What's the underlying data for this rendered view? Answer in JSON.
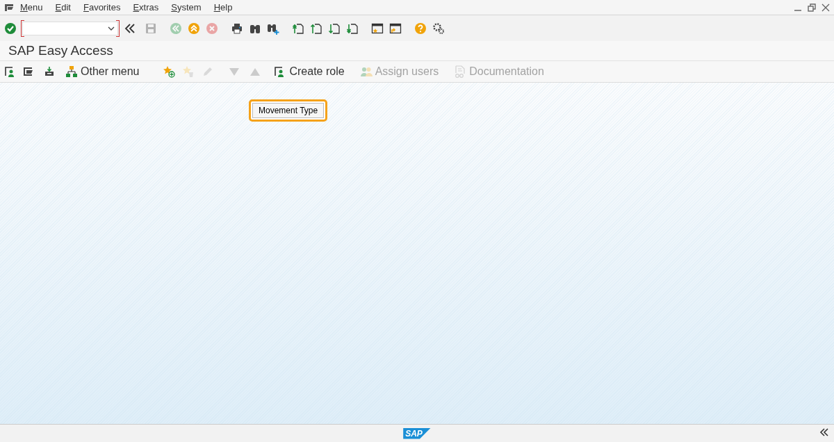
{
  "menu_bar": {
    "items": [
      "Menu",
      "Edit",
      "Favorites",
      "Extras",
      "System",
      "Help"
    ]
  },
  "system_toolbar": {
    "items": [
      {
        "kind": "enter",
        "disabled": false
      },
      {
        "kind": "command-field",
        "disabled": false
      },
      {
        "kind": "collapse",
        "disabled": false
      },
      {
        "kind": "save",
        "disabled": true
      },
      {
        "kind": "back",
        "disabled": true
      },
      {
        "kind": "exit",
        "disabled": false
      },
      {
        "kind": "cancel",
        "disabled": true
      },
      {
        "kind": "print",
        "disabled": false
      },
      {
        "kind": "find",
        "disabled": false
      },
      {
        "kind": "find-next",
        "disabled": false
      },
      {
        "kind": "first-page",
        "disabled": false
      },
      {
        "kind": "previous-page",
        "disabled": false
      },
      {
        "kind": "next-page",
        "disabled": false
      },
      {
        "kind": "last-page",
        "disabled": false
      },
      {
        "kind": "new-session",
        "disabled": false
      },
      {
        "kind": "shortcut",
        "disabled": false
      },
      {
        "kind": "help",
        "disabled": false
      },
      {
        "kind": "settings",
        "disabled": false
      }
    ]
  },
  "title": "SAP Easy Access",
  "application_toolbar": {
    "items": [
      {
        "kind": "user-menu",
        "disabled": false
      },
      {
        "kind": "sap-menu",
        "disabled": false
      },
      {
        "kind": "business-workplace",
        "disabled": false
      },
      {
        "kind": "other-menu",
        "label": "Other menu",
        "disabled": false
      },
      {
        "kind": "add-favorite",
        "disabled": false
      },
      {
        "kind": "delete-favorite",
        "disabled": true
      },
      {
        "kind": "edit",
        "disabled": true
      },
      {
        "kind": "move-down",
        "disabled": true
      },
      {
        "kind": "move-up",
        "disabled": true
      },
      {
        "kind": "create-role",
        "label": "Create role",
        "disabled": false
      },
      {
        "kind": "assign-users",
        "label": "Assign users",
        "disabled": true
      },
      {
        "kind": "documentation",
        "label": "Documentation",
        "disabled": true
      }
    ]
  },
  "callout": {
    "label": "Movement Type"
  },
  "status_bar": {
    "logo": "SAP"
  }
}
